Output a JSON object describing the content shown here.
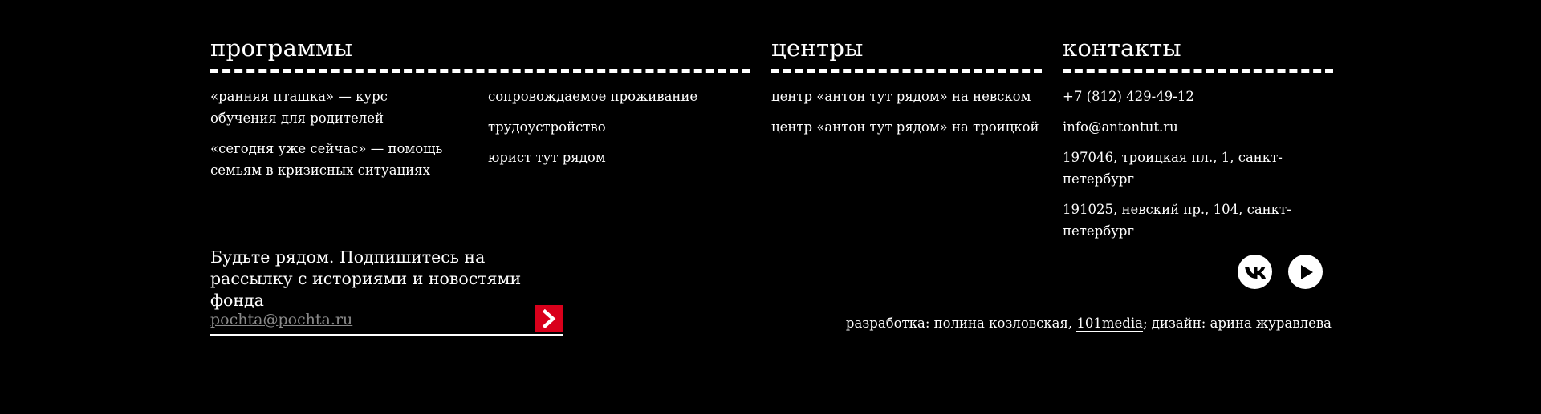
{
  "programs": {
    "heading": "программы",
    "left_items": [
      "«ранняя пташка» — курс обучения для родителей",
      "«сегодня уже сейчас» — помощь семьям в кризисных ситуациях"
    ],
    "right_items": [
      "сопровождаемое проживание",
      "трудоустройство",
      "юрист тут рядом"
    ]
  },
  "centers": {
    "heading": "центры",
    "items": [
      "центр «антон тут рядом» на невском",
      "центр «антон тут рядом» на троицкой"
    ]
  },
  "contacts": {
    "heading": "контакты",
    "phone": "+7 (812) 429-49-12",
    "email": "info@antontut.ru",
    "address_1": "197046, троицкая пл., 1, санкт-петербург",
    "address_2": "191025, невский пр., 104, санкт-петербург"
  },
  "subscribe": {
    "text": "Будьте рядом. Подпишитесь на рассылку с историями и новостями фонда",
    "placeholder": "pochta@pochta.ru",
    "submit_icon": "chevron-right-icon"
  },
  "socials": [
    {
      "name": "vk",
      "icon": "vk-icon"
    },
    {
      "name": "youtube",
      "icon": "play-icon"
    }
  ],
  "credits": {
    "prefix": "разработка: полина козловская,",
    "studio": "101media",
    "suffix": "; дизайн: арина журавлева"
  },
  "colors": {
    "background": "#000000",
    "text": "#ffffff",
    "accent": "#d9001b",
    "placeholder": "#8a8a8a"
  }
}
